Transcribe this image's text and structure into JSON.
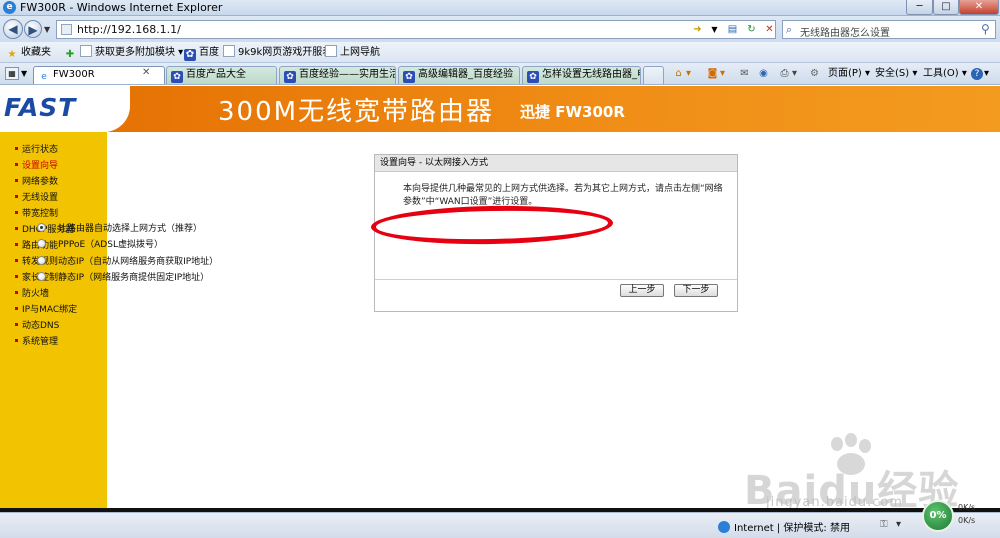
{
  "window": {
    "title": "FW300R - Windows Internet Explorer",
    "controls": {
      "minimize": "─",
      "maximize": "□",
      "close": "✕"
    }
  },
  "address_bar": {
    "url": "http://192.168.1.1/",
    "search_placeholder": "无线路由器怎么设置"
  },
  "favorites_bar": {
    "favorites_label": "收藏夹",
    "items": [
      "获取更多附加模块 ▾",
      "百度",
      "9k9k网页游戏开服表",
      "上网导航"
    ]
  },
  "tabs": [
    {
      "label": "FW300R",
      "active": true
    },
    {
      "label": "百度产品大全",
      "active": false
    },
    {
      "label": "百度经验——实用生活...",
      "active": false
    },
    {
      "label": "高级编辑器_百度经验",
      "active": false
    },
    {
      "label": "怎样设置无线路由器_电...",
      "active": false
    }
  ],
  "command_bar": {
    "page": "页面(P) ▾",
    "safety": "安全(S) ▾",
    "tools": "工具(O) ▾",
    "help": "▾"
  },
  "router": {
    "logo": "FAST",
    "title": "300M无线宽带路由器",
    "model": "迅捷 FW300R",
    "menu": [
      {
        "label": "运行状态",
        "active": false
      },
      {
        "label": "设置向导",
        "active": true
      },
      {
        "label": "网络参数",
        "active": false
      },
      {
        "label": "无线设置",
        "active": false
      },
      {
        "label": "带宽控制",
        "active": false
      },
      {
        "label": "DHCP服务器",
        "active": false
      },
      {
        "label": "路由功能",
        "active": false
      },
      {
        "label": "转发规则",
        "active": false
      },
      {
        "label": "家长控制",
        "active": false
      },
      {
        "label": "防火墙",
        "active": false
      },
      {
        "label": "IP与MAC绑定",
        "active": false
      },
      {
        "label": "动态DNS",
        "active": false
      },
      {
        "label": "系统管理",
        "active": false
      }
    ],
    "wizard": {
      "heading": "设置向导 - 以太网接入方式",
      "description": "本向导提供几种最常见的上网方式供选择。若为其它上网方式，请点击左侧“网络参数”中“WAN口设置”进行设置。",
      "options": [
        {
          "label": "让路由器自动选择上网方式（推荐）",
          "checked": true
        },
        {
          "label": "PPPoE（ADSL虚拟拨号）",
          "checked": false
        },
        {
          "label": "动态IP（自动从网络服务商获取IP地址）",
          "checked": false
        },
        {
          "label": "静态IP（网络服务商提供固定IP地址）",
          "checked": false
        }
      ],
      "prev_button": "上一步",
      "next_button": "下一步"
    }
  },
  "watermark": {
    "logo": "Baidu经验",
    "url": "jingyan.baidu.com"
  },
  "status_bar": {
    "zone": "Internet | 保护模式: 禁用",
    "zoom": "▾",
    "progress": "0%",
    "speed_up": "0K/s",
    "speed_down": "0K/s"
  },
  "colors": {
    "header_orange": "#f08d16",
    "sidebar_yellow": "#f2c300",
    "logo_blue": "#1b4aa4",
    "annotation_red": "#e60012",
    "active_menu": "#cc0000"
  }
}
